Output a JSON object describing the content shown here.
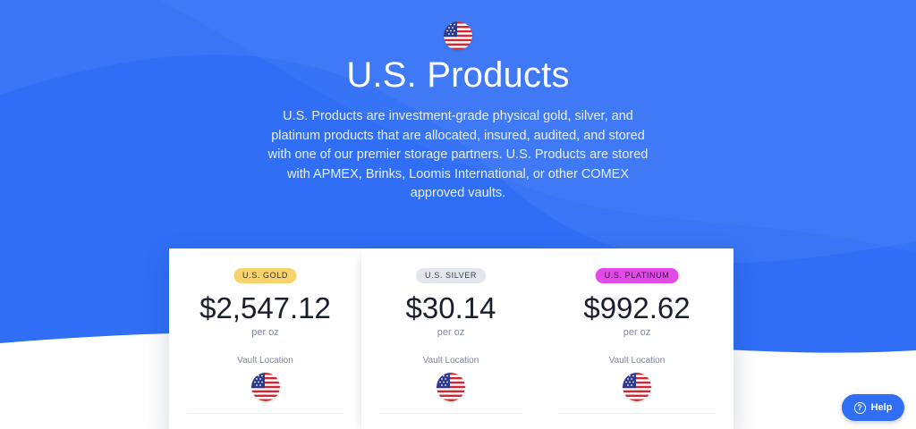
{
  "hero": {
    "title": "U.S. Products",
    "description": "U.S. Products are investment-grade physical gold, silver, and platinum products that are allocated, insured, audited, and stored with one of our premier storage partners. U.S. Products are stored with APMEX, Brinks, Loomis International, or other COMEX approved vaults.",
    "icon": "us-flag-icon"
  },
  "colors": {
    "hero_blue": "#2f6ef5",
    "gold_badge": "#f6d36b",
    "silver_badge": "#e3e6ec",
    "platinum_badge": "#e24ae8"
  },
  "products": [
    {
      "badge": "U.S. GOLD",
      "price": "$2,547.12",
      "unit": "per oz",
      "vault_label": "Vault Location",
      "vault_icon": "us-flag-icon"
    },
    {
      "badge": "U.S. SILVER",
      "price": "$30.14",
      "unit": "per oz",
      "vault_label": "Vault Location",
      "vault_icon": "us-flag-icon"
    },
    {
      "badge": "U.S. PLATINUM",
      "price": "$992.62",
      "unit": "per oz",
      "vault_label": "Vault Location",
      "vault_icon": "us-flag-icon"
    }
  ],
  "help": {
    "label": "Help",
    "icon": "question-circle-icon"
  }
}
